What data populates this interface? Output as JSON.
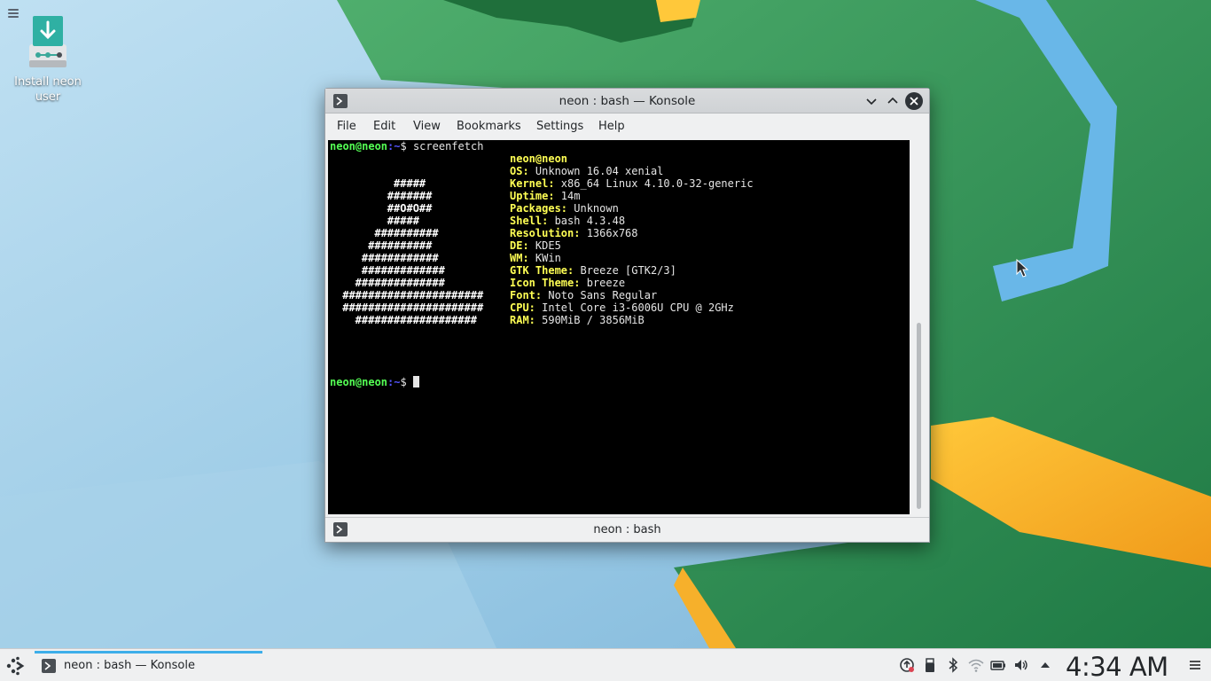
{
  "desktop": {
    "icon_label": "Install neon user",
    "icon_name": "install-download-icon"
  },
  "window": {
    "title": "neon : bash — Konsole",
    "menu": [
      "File",
      "Edit",
      "View",
      "Bookmarks",
      "Settings",
      "Help"
    ],
    "tab_label": "neon : bash"
  },
  "terminal": {
    "prompt_user": "neon@neon",
    "prompt_path": ":~",
    "prompt_symbol": "$",
    "command": " screenfetch",
    "ascii_art": [
      "",
      "",
      "         #####",
      "        #######",
      "        ##O#O##",
      "        #####",
      "      ##########",
      "     ##########",
      "    ############",
      "    #############",
      "   ##############",
      " ######################",
      " ######################",
      "   ###################"
    ],
    "info_user": "neon@neon",
    "info": [
      {
        "key": "OS:",
        "value": " Unknown 16.04 xenial"
      },
      {
        "key": "Kernel:",
        "value": " x86_64 Linux 4.10.0-32-generic"
      },
      {
        "key": "Uptime:",
        "value": " 14m"
      },
      {
        "key": "Packages:",
        "value": " Unknown"
      },
      {
        "key": "Shell:",
        "value": " bash 4.3.48"
      },
      {
        "key": "Resolution:",
        "value": " 1366x768"
      },
      {
        "key": "DE:",
        "value": " KDE5"
      },
      {
        "key": "WM:",
        "value": " KWin"
      },
      {
        "key": "GTK Theme:",
        "value": " Breeze [GTK2/3]"
      },
      {
        "key": "Icon Theme:",
        "value": " breeze"
      },
      {
        "key": "Font:",
        "value": " Noto Sans Regular"
      },
      {
        "key": "CPU:",
        "value": " Intel Core i3-6006U CPU @ 2GHz"
      },
      {
        "key": "RAM:",
        "value": " 590MiB / 3856MiB"
      }
    ]
  },
  "taskbar": {
    "task_label": "neon : bash — Konsole",
    "clock": "4:34 AM",
    "tray_icons": [
      "updates-icon",
      "usb-device-icon",
      "bluetooth-icon",
      "wifi-icon",
      "battery-icon",
      "volume-icon",
      "tray-expand-icon"
    ]
  },
  "colors": {
    "accent": "#3daee9",
    "terminal_bg": "#000000",
    "prompt_green": "#54ff54",
    "info_yellow": "#ffff54",
    "wallpaper_green": "#2f8a4f",
    "wallpaper_blue": "#5aa8d8",
    "wallpaper_orange": "#f0a020"
  }
}
